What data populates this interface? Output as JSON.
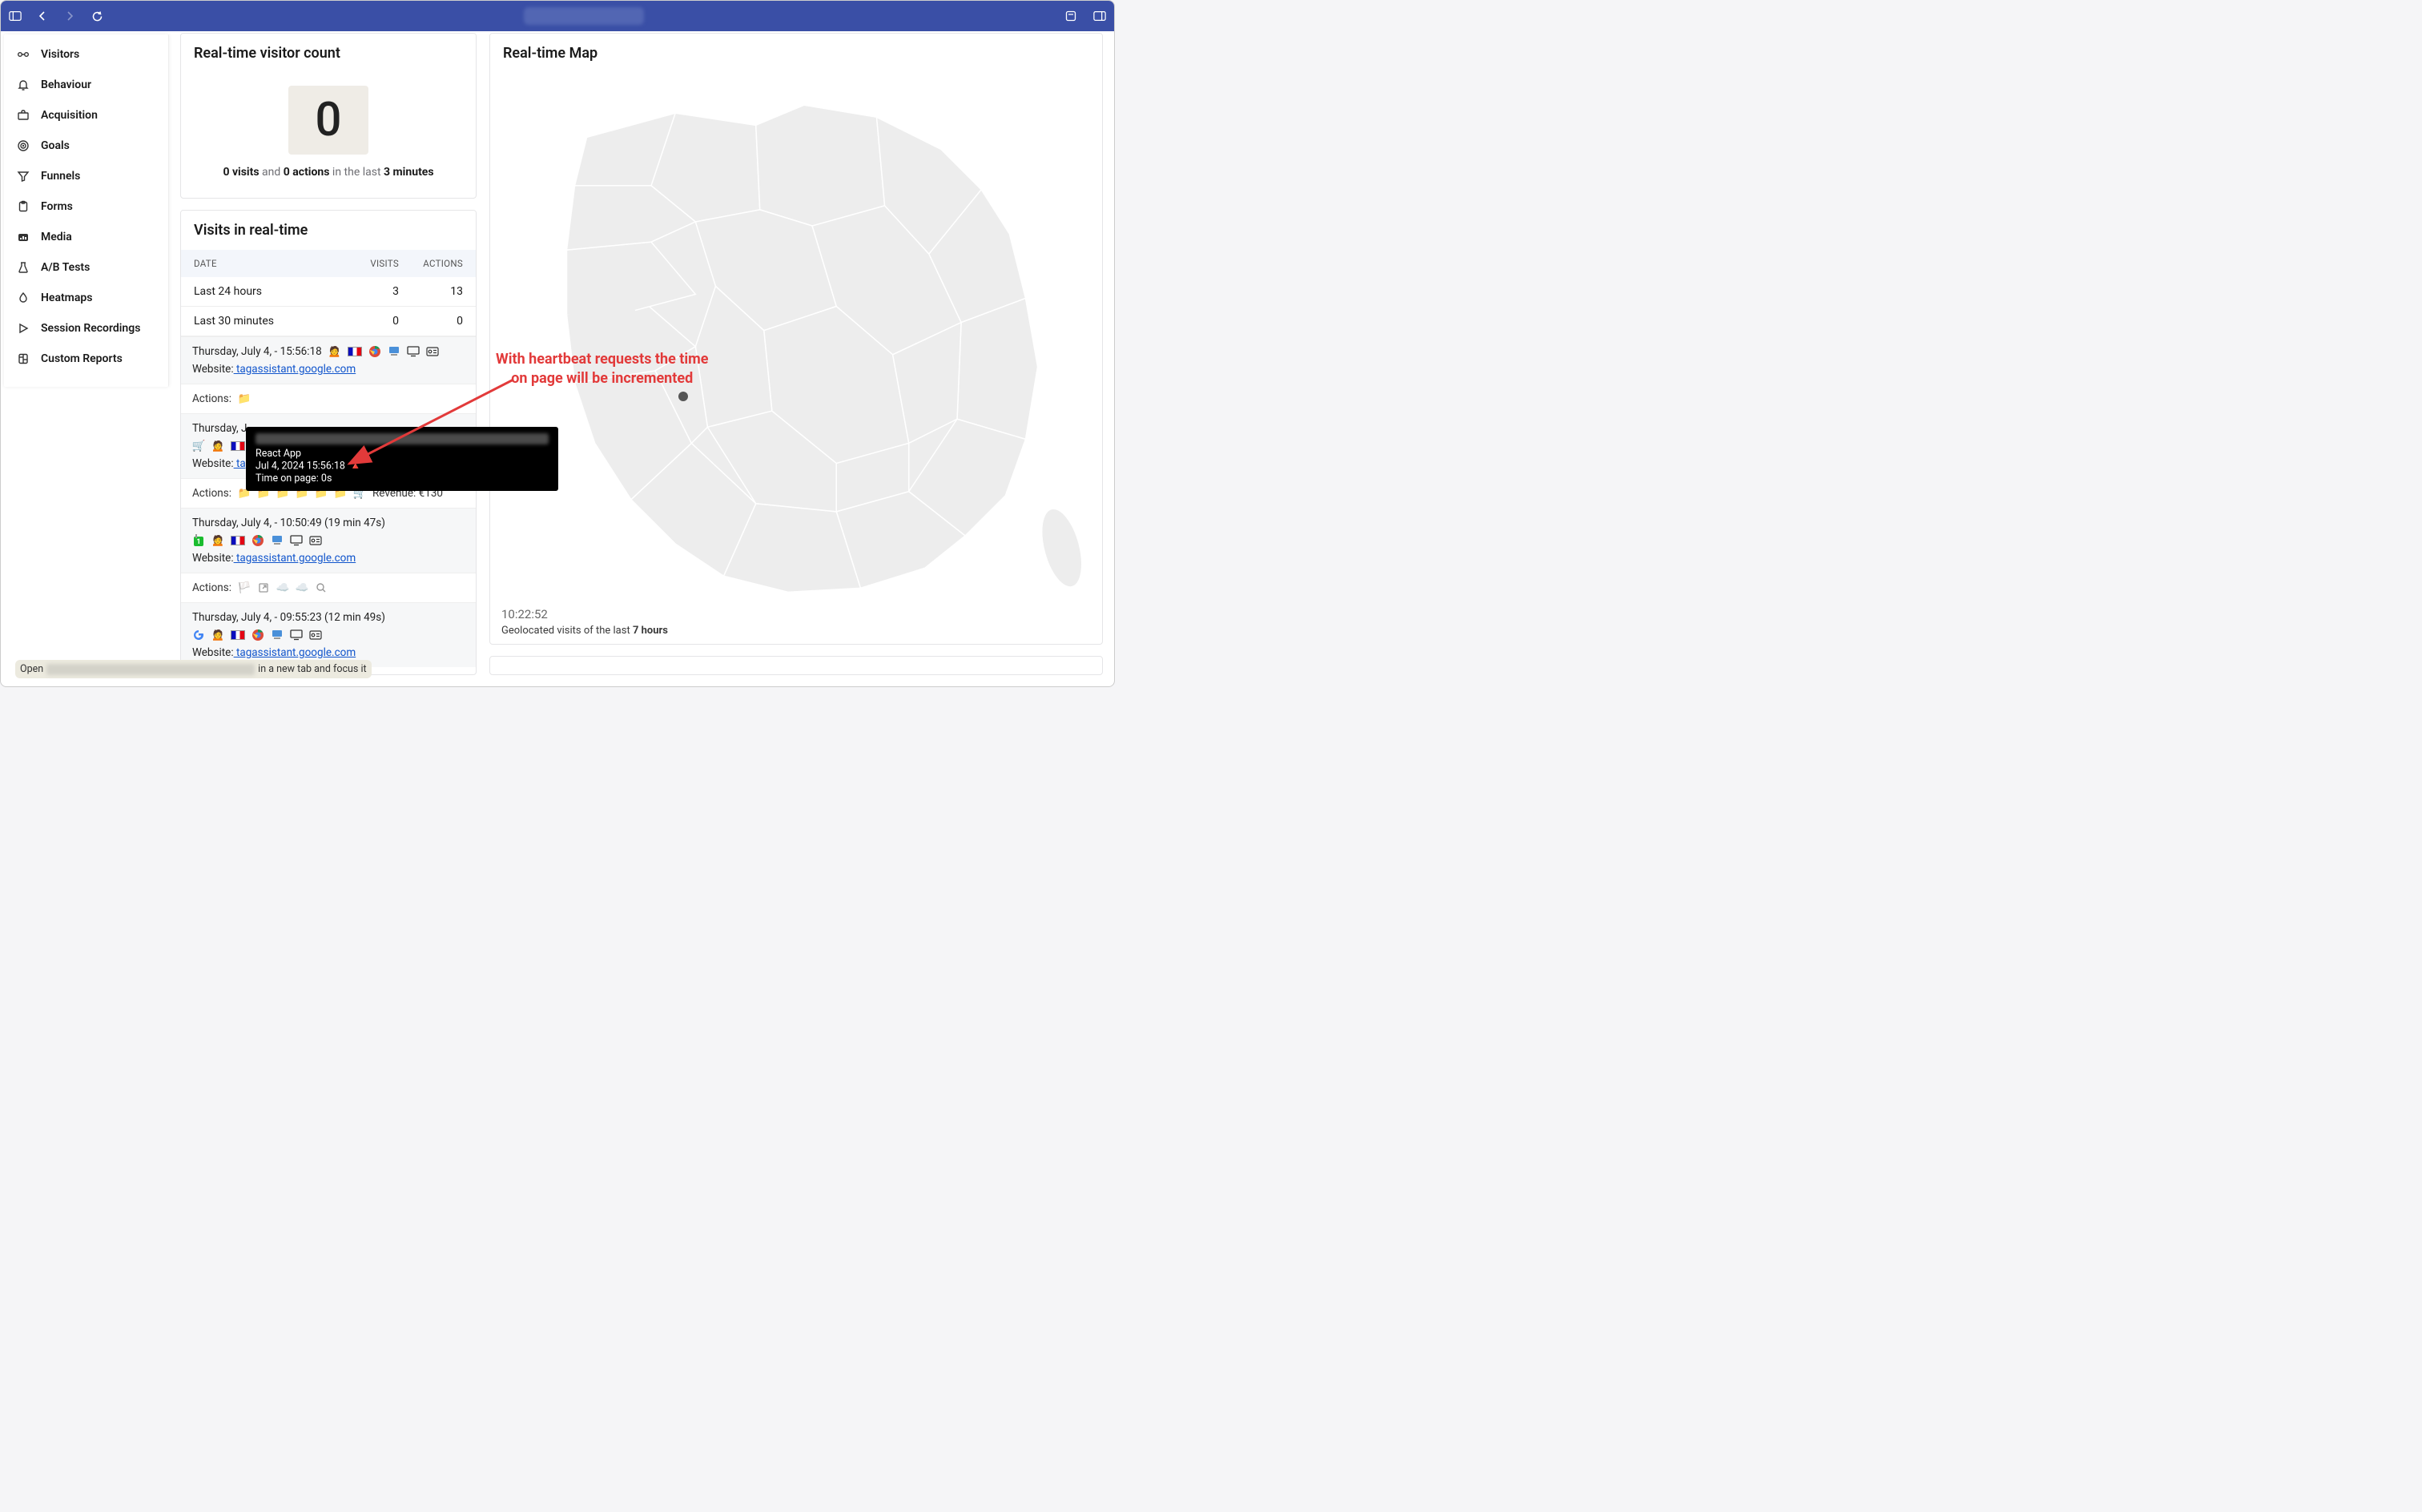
{
  "sidebar": {
    "items": [
      {
        "label": "Visitors",
        "icon": "visitors"
      },
      {
        "label": "Behaviour",
        "icon": "bell"
      },
      {
        "label": "Acquisition",
        "icon": "briefcase"
      },
      {
        "label": "Goals",
        "icon": "target"
      },
      {
        "label": "Funnels",
        "icon": "funnel"
      },
      {
        "label": "Forms",
        "icon": "clipboard"
      },
      {
        "label": "Media",
        "icon": "media"
      },
      {
        "label": "A/B Tests",
        "icon": "flask"
      },
      {
        "label": "Heatmaps",
        "icon": "drop"
      },
      {
        "label": "Session Recordings",
        "icon": "play"
      },
      {
        "label": "Custom Reports",
        "icon": "report"
      }
    ]
  },
  "cards": {
    "visitor_count": {
      "title": "Real-time visitor count",
      "value": "0",
      "caption_visits": "0 visits",
      "caption_and": " and ",
      "caption_actions": "0 actions",
      "caption_in": " in the last ",
      "caption_minutes": "3 minutes"
    },
    "visits": {
      "title": "Visits in real-time",
      "columns": {
        "date": "DATE",
        "visits": "VISITS",
        "actions": "ACTIONS"
      },
      "rows": [
        {
          "date": "Last 24 hours",
          "visits": "3",
          "actions": "13"
        },
        {
          "date": "Last 30 minutes",
          "visits": "0",
          "actions": "0"
        }
      ],
      "entries": [
        {
          "timestamp": "Thursday, July 4, - 15:56:18",
          "website_label": "Website:",
          "website_link": " tagassistant.google.com",
          "actions_label": "Actions:"
        },
        {
          "timestamp_prefix": "Thursday, J",
          "website_label": "Website:",
          "website_link": " tagassistant.google.com",
          "actions_label": "Actions:",
          "revenue_label": "Revenue: €130"
        },
        {
          "timestamp": "Thursday, July 4, - 10:50:49 (19 min 47s)",
          "website_label": "Website:",
          "website_link": " tagassistant.google.com",
          "actions_label": "Actions:"
        },
        {
          "timestamp": "Thursday, July 4, - 09:55:23 (12 min 49s)",
          "website_label": "Website:",
          "website_link": " tagassistant.google.com"
        }
      ]
    },
    "map": {
      "title": "Real-time Map",
      "time": "10:22:52",
      "caption_prefix": "Geolocated visits of the last ",
      "caption_bold": "7 hours"
    }
  },
  "tooltip": {
    "title": "React App",
    "timestamp": "Jul 4, 2024 15:56:18",
    "time_on_page": "Time on page: 0s"
  },
  "annotation": {
    "line1": "With heartbeat requests the time",
    "line2": "on page will be incremented"
  },
  "statusbar": {
    "prefix": "Open",
    "suffix": " in a new tab and focus it"
  }
}
